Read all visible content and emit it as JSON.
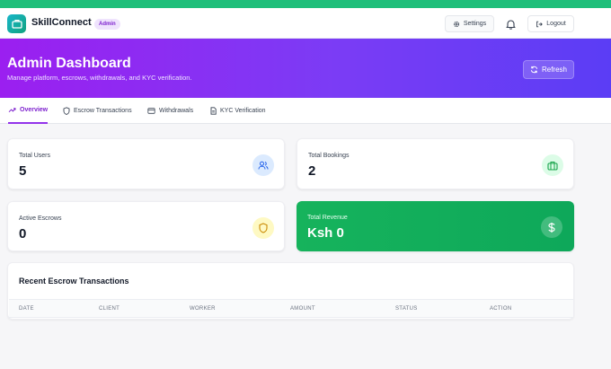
{
  "navbar": {
    "brand": "SkillConnect",
    "role_badge": "Admin",
    "settings_label": "Settings",
    "logout_label": "Logout"
  },
  "hero": {
    "title": "Admin Dashboard",
    "subtitle": "Manage platform, escrows, withdrawals, and KYC verification.",
    "refresh_label": "Refresh"
  },
  "tabs": [
    {
      "label": "Overview",
      "icon": "trending-up-icon",
      "active": true
    },
    {
      "label": "Escrow Transactions",
      "icon": "shield-icon",
      "active": false
    },
    {
      "label": "Withdrawals",
      "icon": "credit-card-icon",
      "active": false
    },
    {
      "label": "KYC Verification",
      "icon": "document-icon",
      "active": false
    }
  ],
  "stats": {
    "total_users": {
      "label": "Total Users",
      "value": "5",
      "icon": "users-icon"
    },
    "total_bookings": {
      "label": "Total Bookings",
      "value": "2",
      "icon": "briefcase-icon"
    },
    "active_escrows": {
      "label": "Active Escrows",
      "value": "0",
      "icon": "shield-icon"
    },
    "total_revenue": {
      "label": "Total Revenue",
      "value": "Ksh 0",
      "icon": "dollar-icon"
    }
  },
  "transactions": {
    "title": "Recent Escrow Transactions",
    "columns": [
      "DATE",
      "CLIENT",
      "WORKER",
      "AMOUNT",
      "STATUS",
      "ACTION"
    ]
  },
  "colors": {
    "accent": "#9333ea",
    "top_strip": "#1fbf7a",
    "revenue_green": "#16b35c",
    "hero_start": "#9b1ff0",
    "hero_end": "#5b3df5"
  }
}
